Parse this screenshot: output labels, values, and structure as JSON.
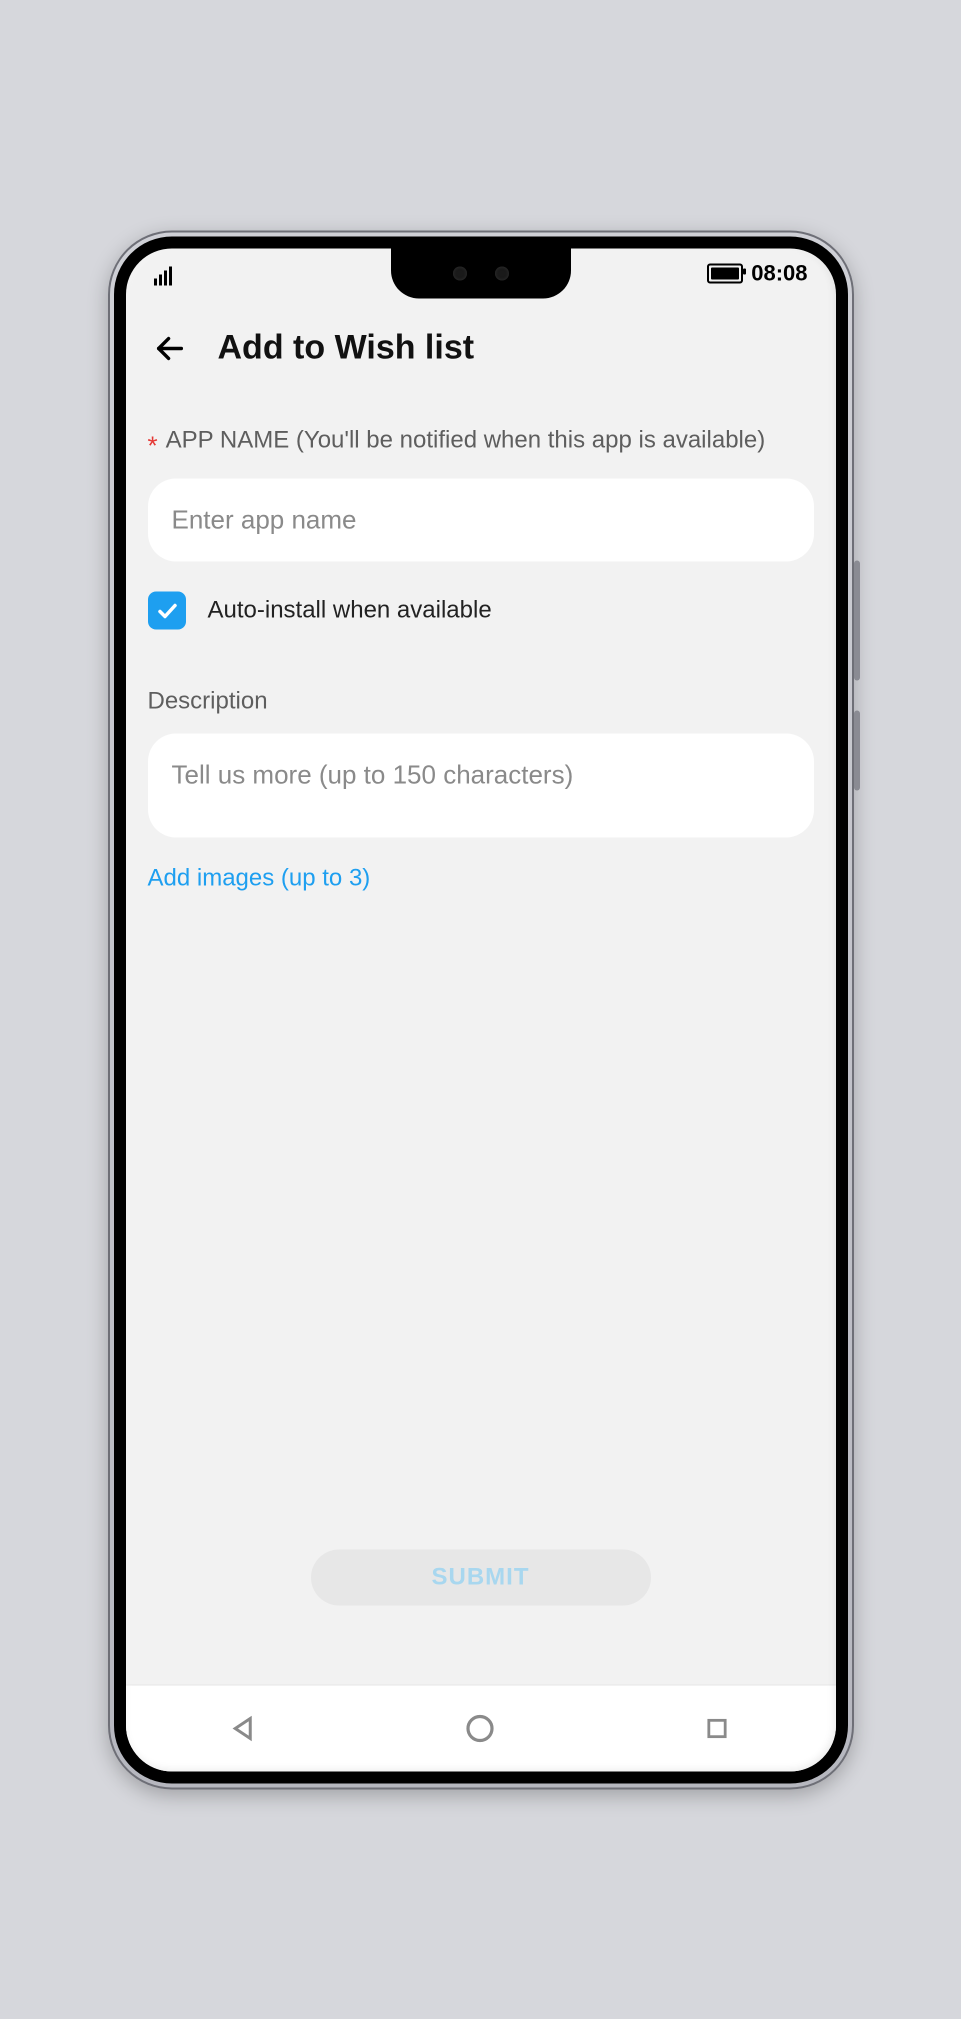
{
  "status": {
    "time": "08:08"
  },
  "header": {
    "title": "Add to Wish list"
  },
  "form": {
    "app_name": {
      "label": "APP NAME (You'll be notified when this app is available)",
      "placeholder": "Enter app name",
      "value": ""
    },
    "auto_install": {
      "label": "Auto-install when available",
      "checked": true
    },
    "description": {
      "label": "Description",
      "placeholder": "Tell us more (up to 150 characters)",
      "value": ""
    },
    "add_images_link": "Add images (up to 3)",
    "submit_label": "SUBMIT"
  },
  "colors": {
    "accent": "#1e9ff0",
    "required": "#e53935"
  }
}
